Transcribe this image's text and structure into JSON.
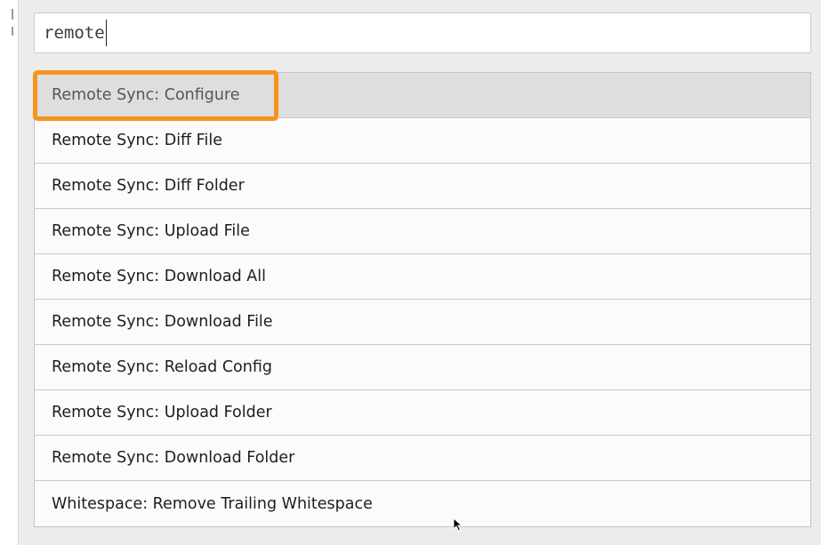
{
  "search": {
    "query": "remote"
  },
  "results": [
    {
      "label": "Remote Sync: Configure",
      "selected": true
    },
    {
      "label": "Remote Sync: Diff File"
    },
    {
      "label": "Remote Sync: Diff Folder"
    },
    {
      "label": "Remote Sync: Upload File"
    },
    {
      "label": "Remote Sync: Download All"
    },
    {
      "label": "Remote Sync: Download File"
    },
    {
      "label": "Remote Sync: Reload Config"
    },
    {
      "label": "Remote Sync: Upload Folder"
    },
    {
      "label": "Remote Sync: Download Folder"
    },
    {
      "label": "Whitespace: Remove Trailing Whitespace"
    }
  ],
  "colors": {
    "highlight": "#f7931e",
    "selected_row": "#dedede",
    "panel_background": "#ececec"
  },
  "icons": {
    "pointer": "mouse-pointer-icon"
  }
}
